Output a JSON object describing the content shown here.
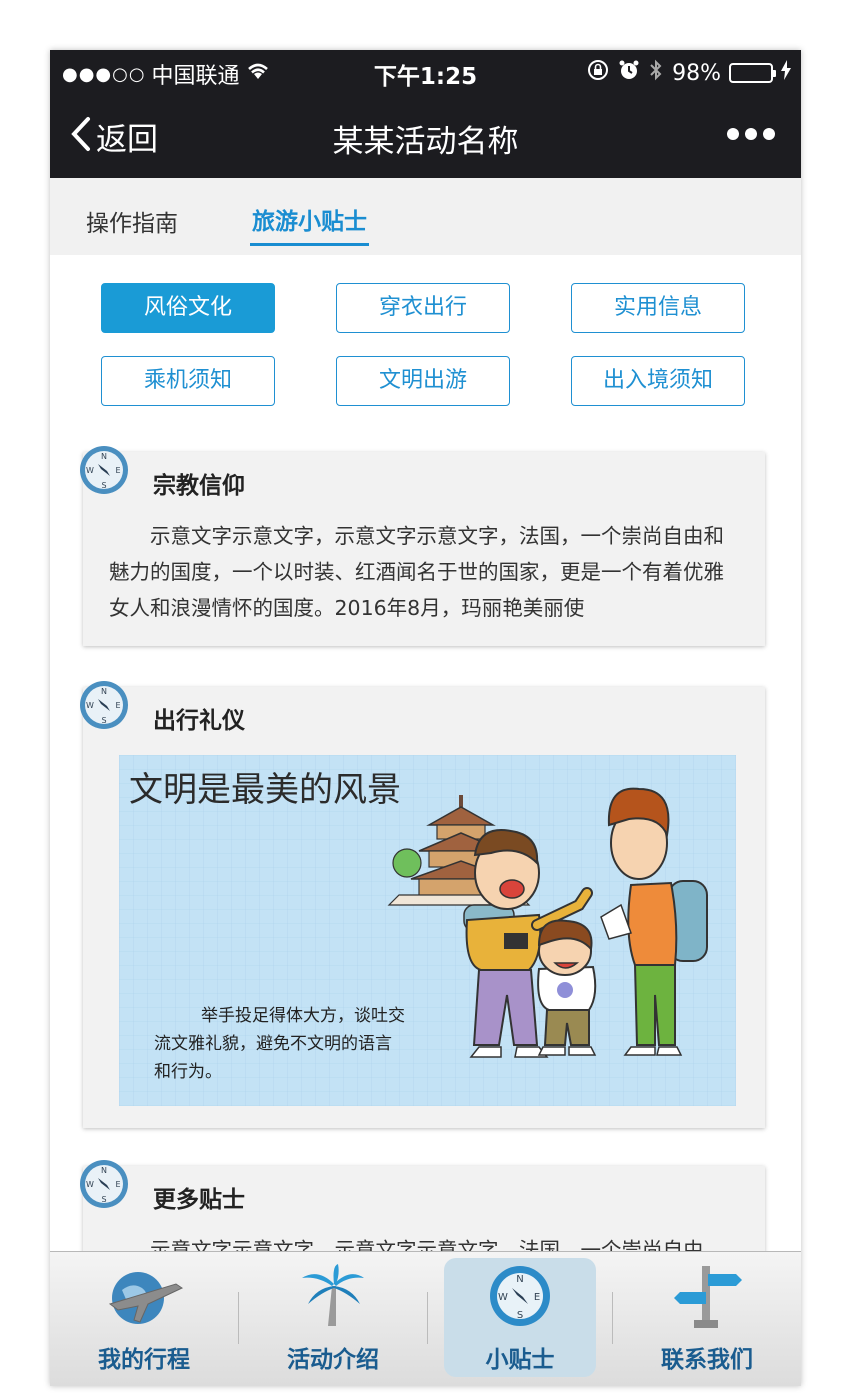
{
  "status": {
    "carrier": "中国联通",
    "time": "下午1:25",
    "battery": "98%",
    "battery_level": 0.98,
    "signal_dots": "●●●○○"
  },
  "nav": {
    "back_label": "返回",
    "title": "某某活动名称"
  },
  "subtabs": [
    {
      "label": "操作指南"
    },
    {
      "label": "旅游小贴士",
      "active": true
    }
  ],
  "categories": [
    {
      "label": "风俗文化",
      "active": true
    },
    {
      "label": "穿衣出行"
    },
    {
      "label": "实用信息"
    },
    {
      "label": "乘机须知"
    },
    {
      "label": "文明出游"
    },
    {
      "label": "出入境须知"
    }
  ],
  "cards": [
    {
      "title": "宗教信仰",
      "text": "示意文字示意文字，示意文字示意文字，法国，一个崇尚自由和魅力的国度，一个以时装、红酒闻名于世的国家，更是一个有着优雅女人和浪漫情怀的国度。2016年8月，玛丽艳美丽使"
    },
    {
      "title": "出行礼仪",
      "image_heading": "文明是最美的风景",
      "image_caption_lines": [
        "举手投足得体大方，谈吐交",
        "流文雅礼貌，避免不文明的语言",
        "和行为。"
      ]
    },
    {
      "title": "更多贴士",
      "text": "示意文字示意文字，示意文字示意文字，法国，一个崇尚自由"
    }
  ],
  "tabbar": [
    {
      "label": "我的行程",
      "icon": "plane-globe-icon"
    },
    {
      "label": "活动介绍",
      "icon": "palm-tree-icon"
    },
    {
      "label": "小贴士",
      "icon": "compass-icon",
      "active": true
    },
    {
      "label": "联系我们",
      "icon": "signpost-icon"
    }
  ],
  "colors": {
    "accent": "#1a9bd6",
    "bar_dark": "#1c1c20",
    "tab_label": "#1a5c8f"
  }
}
